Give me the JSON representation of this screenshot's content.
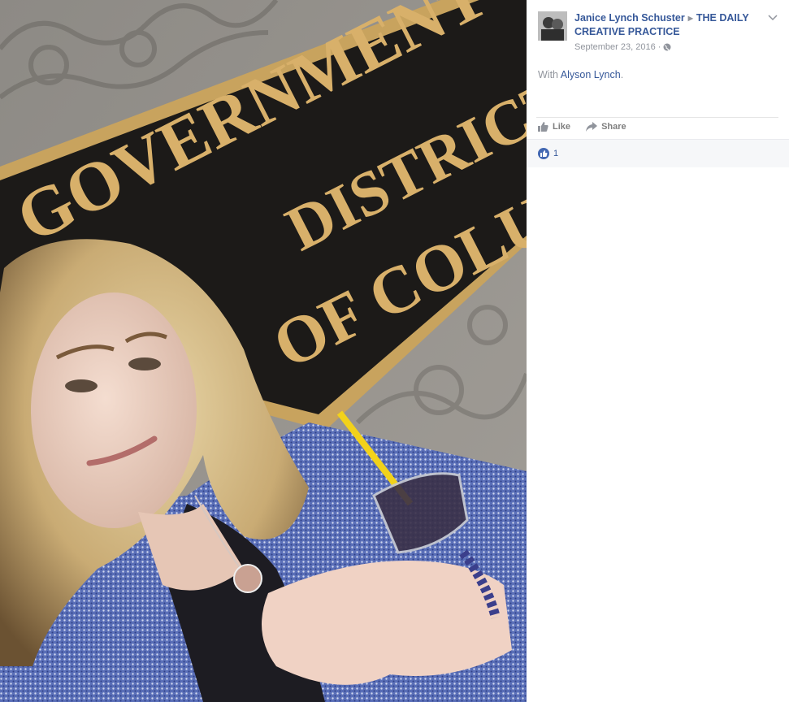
{
  "post": {
    "author": "Janice Lynch Schuster",
    "group": "THE DAILY CREATIVE PRACTICE",
    "date": "September 23, 2016",
    "date_separator": "·",
    "with_prefix": "With",
    "tagged_person": "Alyson Lynch",
    "with_suffix": ".",
    "privacy_icon": "globe-icon"
  },
  "photo": {
    "sign_lines": [
      "GOVERNMENT OF",
      "DISTRICT",
      "OF COLUMBIA"
    ]
  },
  "actions": {
    "like_label": "Like",
    "share_label": "Share"
  },
  "reactions": {
    "count": "1",
    "icon": "thumbs-up-icon"
  },
  "colors": {
    "link": "#365899",
    "muted": "#90949c",
    "like_blue": "#4267b2",
    "reaction_bar": "#f6f7f9"
  }
}
